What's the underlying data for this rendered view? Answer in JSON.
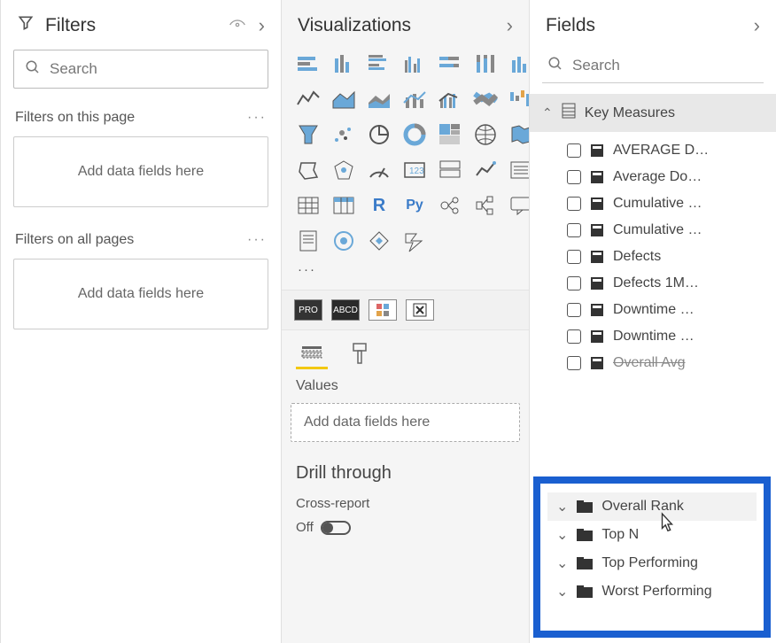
{
  "filters": {
    "title": "Filters",
    "search_placeholder": "Search",
    "section_page": "Filters on this page",
    "section_all": "Filters on all pages",
    "drop_text": "Add data fields here"
  },
  "viz": {
    "title": "Visualizations",
    "values_label": "Values",
    "values_drop": "Add data fields here",
    "drill_header": "Drill through",
    "drill_sub": "Cross-report",
    "toggle_off": "Off",
    "mode_chips": [
      "PRO",
      "ABCD"
    ]
  },
  "fields": {
    "title": "Fields",
    "search_placeholder": "Search",
    "table_name": "Key Measures",
    "measures": [
      "AVERAGE D…",
      "Average Do…",
      "Cumulative …",
      "Cumulative …",
      "Defects",
      "Defects 1M…",
      "Downtime …",
      "Downtime …"
    ],
    "partial_measure": "Overall Avg",
    "groups": [
      "Overall Rank",
      "Top N",
      "Top Performing",
      "Worst Performing"
    ]
  }
}
